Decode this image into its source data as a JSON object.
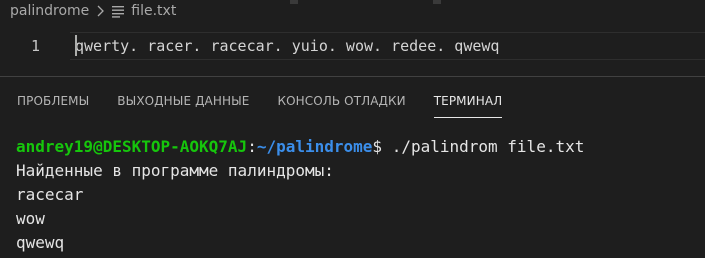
{
  "breadcrumb": {
    "folder": "palindrome",
    "file": "file.txt"
  },
  "editor": {
    "line_number": "1",
    "line_text": "qwerty. racer. racecar. yuio. wow. redee. qwewq"
  },
  "panel": {
    "tabs": [
      {
        "label": "ПРОБЛЕМЫ",
        "active": false
      },
      {
        "label": "ВЫХОДНЫЕ ДАННЫЕ",
        "active": false
      },
      {
        "label": "КОНСОЛЬ ОТЛАДКИ",
        "active": false
      },
      {
        "label": "ТЕРМИНАЛ",
        "active": true
      }
    ]
  },
  "terminal": {
    "user_host": "andrey19@DESKTOP-AOKQ7AJ",
    "colon": ":",
    "path": "~/palindrome",
    "prompt_symbol": "$",
    "command": " ./palindrom file.txt",
    "output": [
      "Найденные в программе палиндромы:",
      "racecar",
      "wow",
      "qwewq"
    ]
  },
  "colors": {
    "background": "#1e1e1e",
    "user_host": "#16c60c",
    "path": "#3b8eea"
  }
}
